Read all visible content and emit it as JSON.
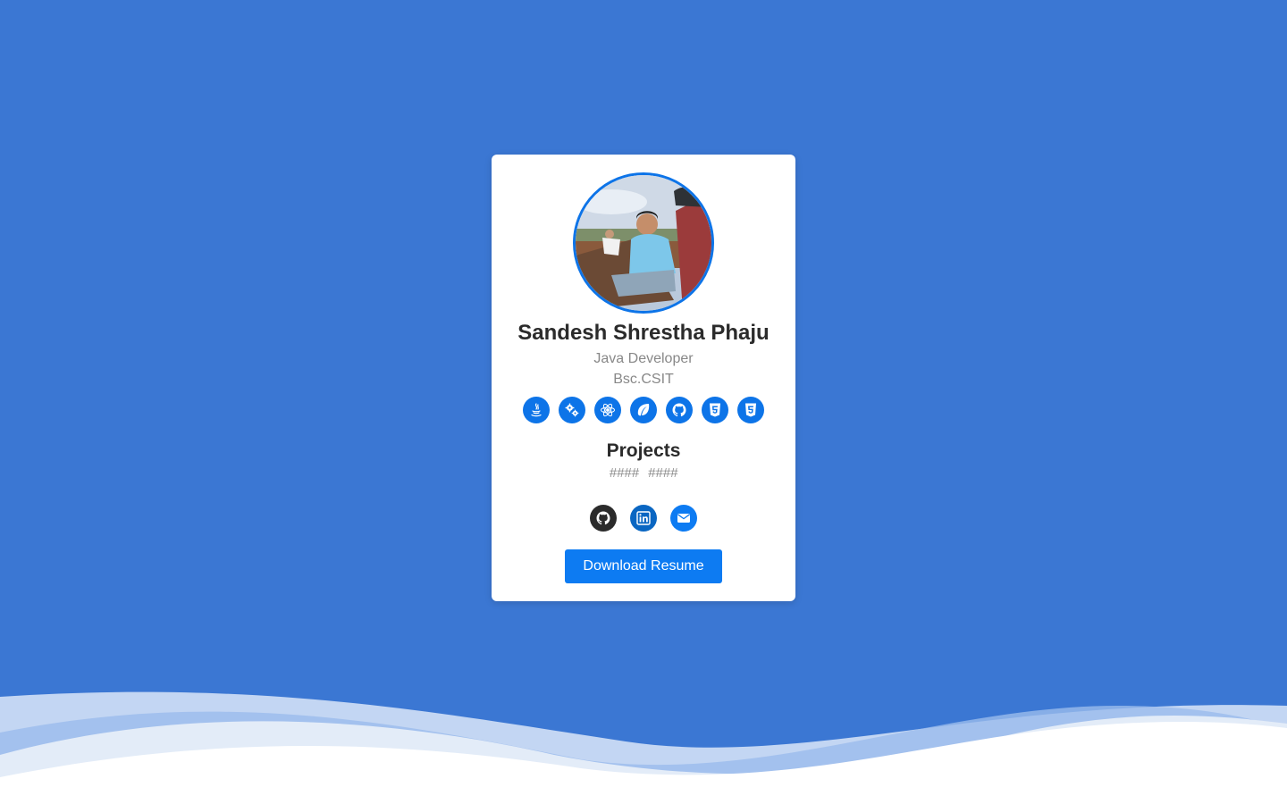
{
  "profile": {
    "name": "Sandesh Shrestha Phaju",
    "role": "Java Developer",
    "degree": "Bsc.CSIT",
    "photo_icon": "profile-photo"
  },
  "skills": [
    {
      "icon": "java-icon"
    },
    {
      "icon": "gears-icon"
    },
    {
      "icon": "react-icon"
    },
    {
      "icon": "leaf-icon"
    },
    {
      "icon": "github-icon"
    },
    {
      "icon": "html5-icon"
    },
    {
      "icon": "css3-icon"
    }
  ],
  "projects": {
    "title": "Projects",
    "items": [
      "####",
      "####"
    ]
  },
  "social": [
    {
      "icon": "github-icon",
      "color": "#2b2b2b"
    },
    {
      "icon": "linkedin-icon",
      "color": "#0a66c2"
    },
    {
      "icon": "envelope-icon",
      "color": "#0d7bf2"
    }
  ],
  "download_label": "Download Resume",
  "colors": {
    "background": "#3b77d3",
    "accent": "#0d74e8",
    "button": "#0d7bf2"
  }
}
